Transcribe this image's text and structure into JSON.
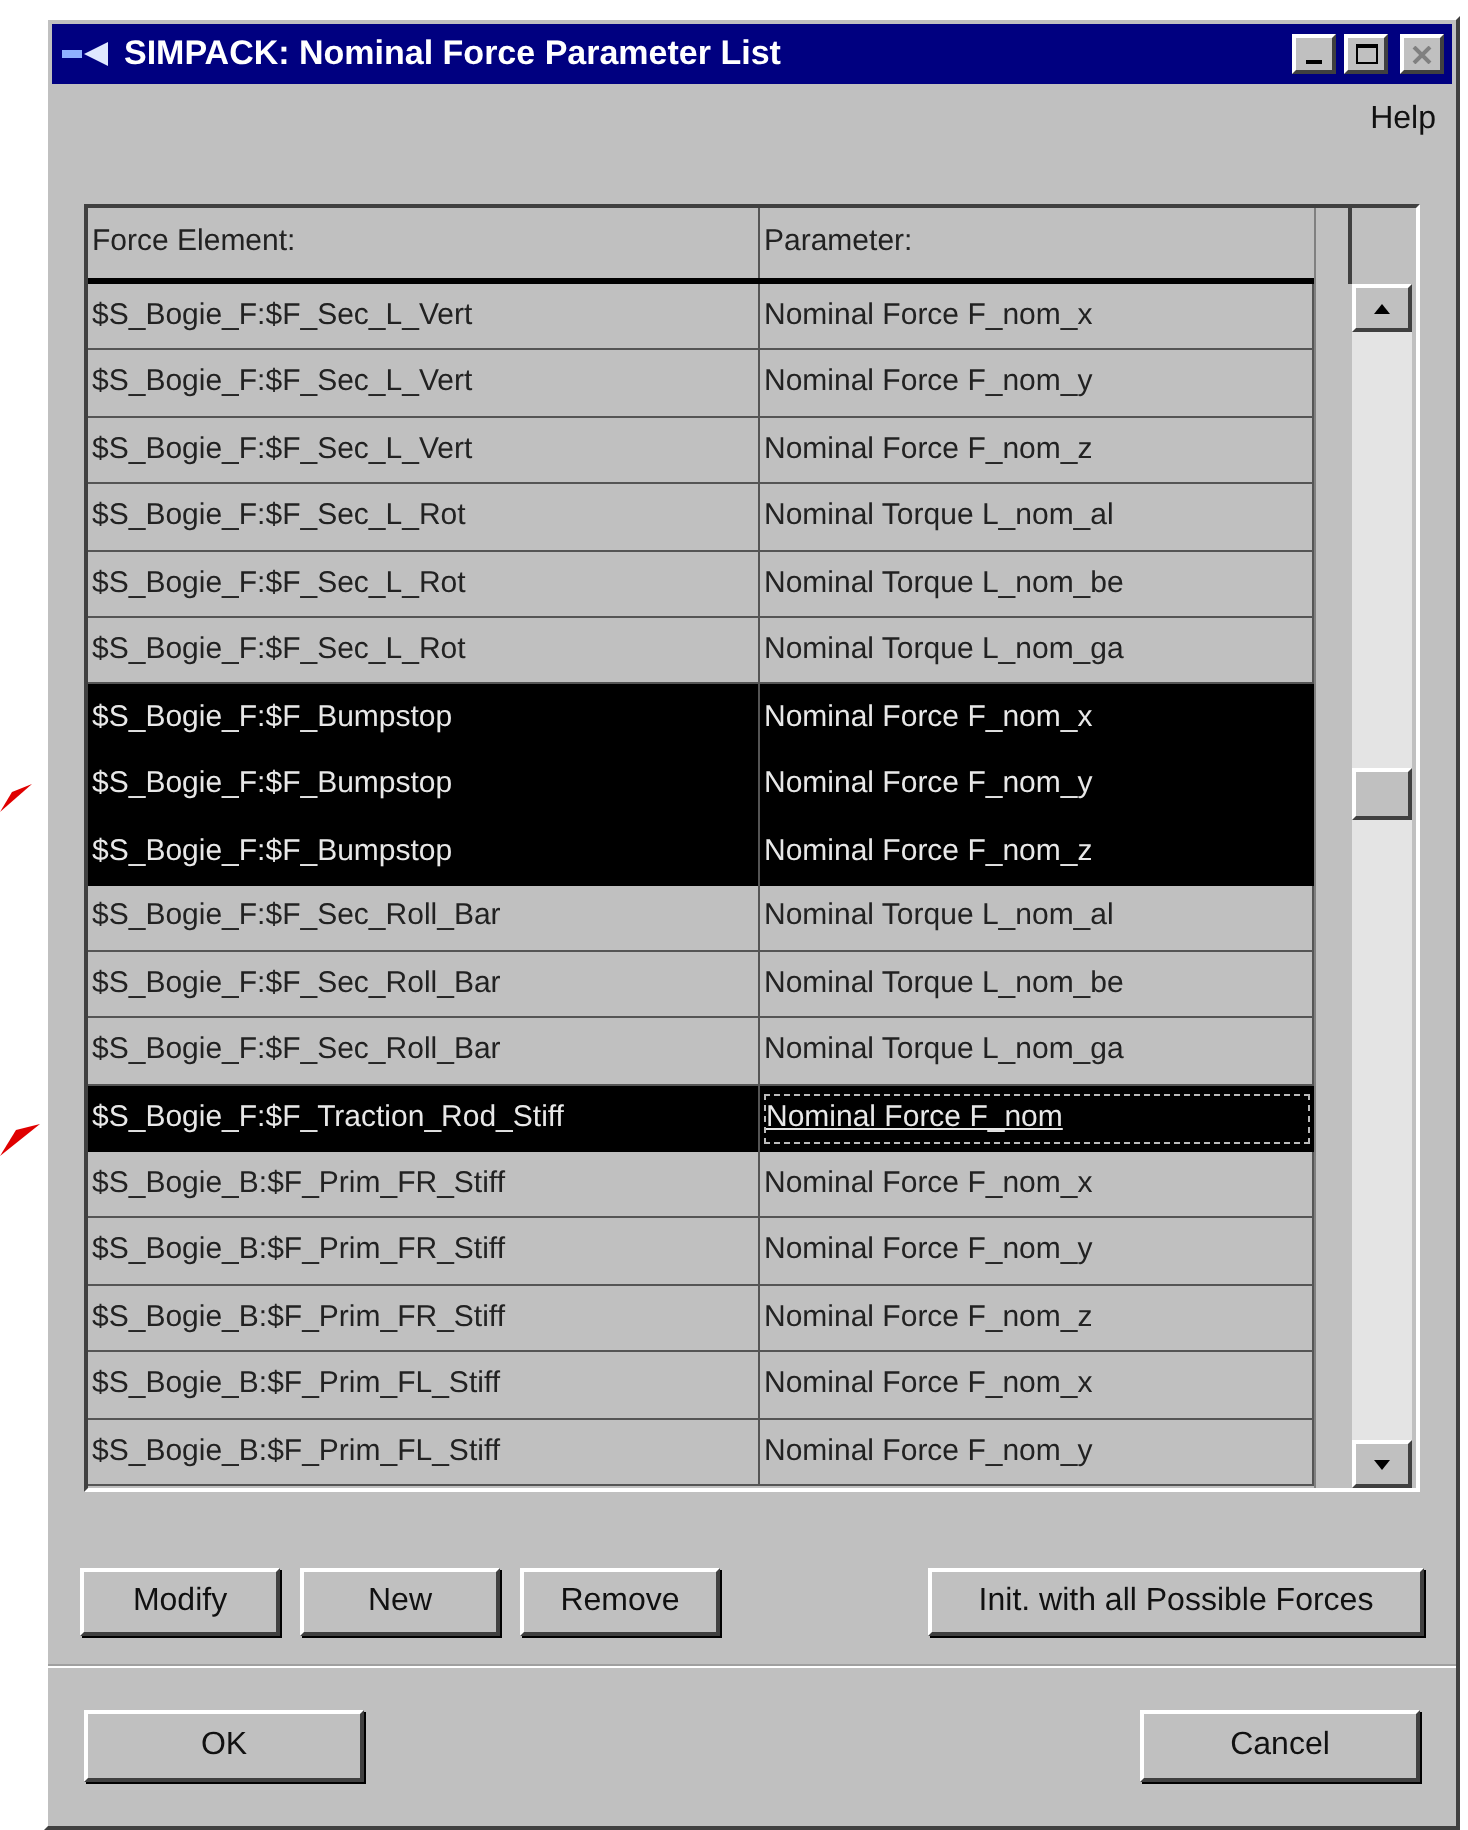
{
  "window": {
    "title": "SIMPACK: Nominal Force Parameter List"
  },
  "menu": [
    "Help"
  ],
  "table": {
    "columns": [
      "Force Element:",
      "Parameter:"
    ],
    "rows": [
      {
        "cells": [
          "$S_Bogie_F:$F_Sec_L_Vert",
          "Nominal Force F_nom_x"
        ],
        "selected": false,
        "focused": false
      },
      {
        "cells": [
          "$S_Bogie_F:$F_Sec_L_Vert",
          "Nominal Force F_nom_y"
        ],
        "selected": false,
        "focused": false
      },
      {
        "cells": [
          "$S_Bogie_F:$F_Sec_L_Vert",
          "Nominal Force F_nom_z"
        ],
        "selected": false,
        "focused": false
      },
      {
        "cells": [
          "$S_Bogie_F:$F_Sec_L_Rot",
          "Nominal Torque L_nom_al"
        ],
        "selected": false,
        "focused": false
      },
      {
        "cells": [
          "$S_Bogie_F:$F_Sec_L_Rot",
          "Nominal Torque L_nom_be"
        ],
        "selected": false,
        "focused": false
      },
      {
        "cells": [
          "$S_Bogie_F:$F_Sec_L_Rot",
          "Nominal Torque L_nom_ga"
        ],
        "selected": false,
        "focused": false
      },
      {
        "cells": [
          "$S_Bogie_F:$F_Bumpstop",
          "Nominal Force F_nom_x"
        ],
        "selected": true,
        "focused": false
      },
      {
        "cells": [
          "$S_Bogie_F:$F_Bumpstop",
          "Nominal Force F_nom_y"
        ],
        "selected": true,
        "focused": false
      },
      {
        "cells": [
          "$S_Bogie_F:$F_Bumpstop",
          "Nominal Force F_nom_z"
        ],
        "selected": true,
        "focused": false
      },
      {
        "cells": [
          "$S_Bogie_F:$F_Sec_Roll_Bar",
          "Nominal Torque L_nom_al"
        ],
        "selected": false,
        "focused": false
      },
      {
        "cells": [
          "$S_Bogie_F:$F_Sec_Roll_Bar",
          "Nominal Torque L_nom_be"
        ],
        "selected": false,
        "focused": false
      },
      {
        "cells": [
          "$S_Bogie_F:$F_Sec_Roll_Bar",
          "Nominal Torque L_nom_ga"
        ],
        "selected": false,
        "focused": false
      },
      {
        "cells": [
          "$S_Bogie_F:$F_Traction_Rod_Stiff",
          "Nominal Force F_nom"
        ],
        "selected": true,
        "focused": true
      },
      {
        "cells": [
          "$S_Bogie_B:$F_Prim_FR_Stiff",
          "Nominal Force F_nom_x"
        ],
        "selected": false,
        "focused": false
      },
      {
        "cells": [
          "$S_Bogie_B:$F_Prim_FR_Stiff",
          "Nominal Force F_nom_y"
        ],
        "selected": false,
        "focused": false
      },
      {
        "cells": [
          "$S_Bogie_B:$F_Prim_FR_Stiff",
          "Nominal Force F_nom_z"
        ],
        "selected": false,
        "focused": false
      },
      {
        "cells": [
          "$S_Bogie_B:$F_Prim_FL_Stiff",
          "Nominal Force F_nom_x"
        ],
        "selected": false,
        "focused": false
      },
      {
        "cells": [
          "$S_Bogie_B:$F_Prim_FL_Stiff",
          "Nominal Force F_nom_y"
        ],
        "selected": false,
        "focused": false
      }
    ]
  },
  "actions": [
    "Modify",
    "New",
    "Remove",
    "Init. with all Possible Forces"
  ],
  "buttons": [
    "OK",
    "Cancel"
  ]
}
